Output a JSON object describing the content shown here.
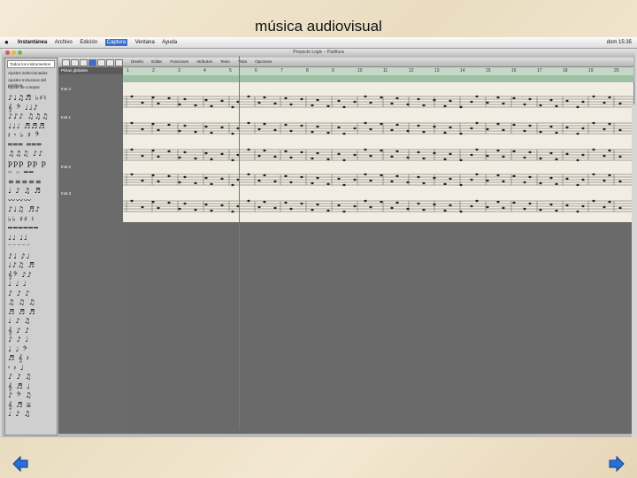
{
  "slide": {
    "title": "música audiovisual"
  },
  "menubar": {
    "app": "Instantánea",
    "items": [
      "Archivo",
      "Edición",
      "Captura",
      "Ventana",
      "Ayuda"
    ],
    "active": "Captura",
    "clock": "dom 15:35"
  },
  "window": {
    "title": "Proyecto Logic – Partitura"
  },
  "sidebar": {
    "selector": "Todos los instrumentos",
    "sections": [
      "Ajustes seleccionados",
      "Ajustes Inclusivos del partitura",
      "Ajuste de compas"
    ]
  },
  "toolbar": {
    "menus": [
      "Diseño",
      "Editar",
      "Funciones",
      "Atributos",
      "Texto",
      "Vista",
      "Opciones"
    ]
  },
  "tracks": {
    "header": "Pistas globales",
    "names": [
      "Inst 4",
      "Inst 1",
      "Inst 2",
      "Inst 3"
    ]
  },
  "ruler": {
    "bars": [
      "1",
      "2",
      "3",
      "4",
      "5",
      "6",
      "7",
      "8",
      "9",
      "10",
      "11",
      "12",
      "13",
      "14",
      "15",
      "16",
      "17",
      "18",
      "19",
      "20"
    ]
  },
  "colors": {
    "playhead": "#3aa04a",
    "score_bg": "#f1ede2",
    "arrow": "#2a6fd6"
  },
  "icons": [
    "apple-icon",
    "back-arrow-icon",
    "forward-arrow-icon"
  ]
}
